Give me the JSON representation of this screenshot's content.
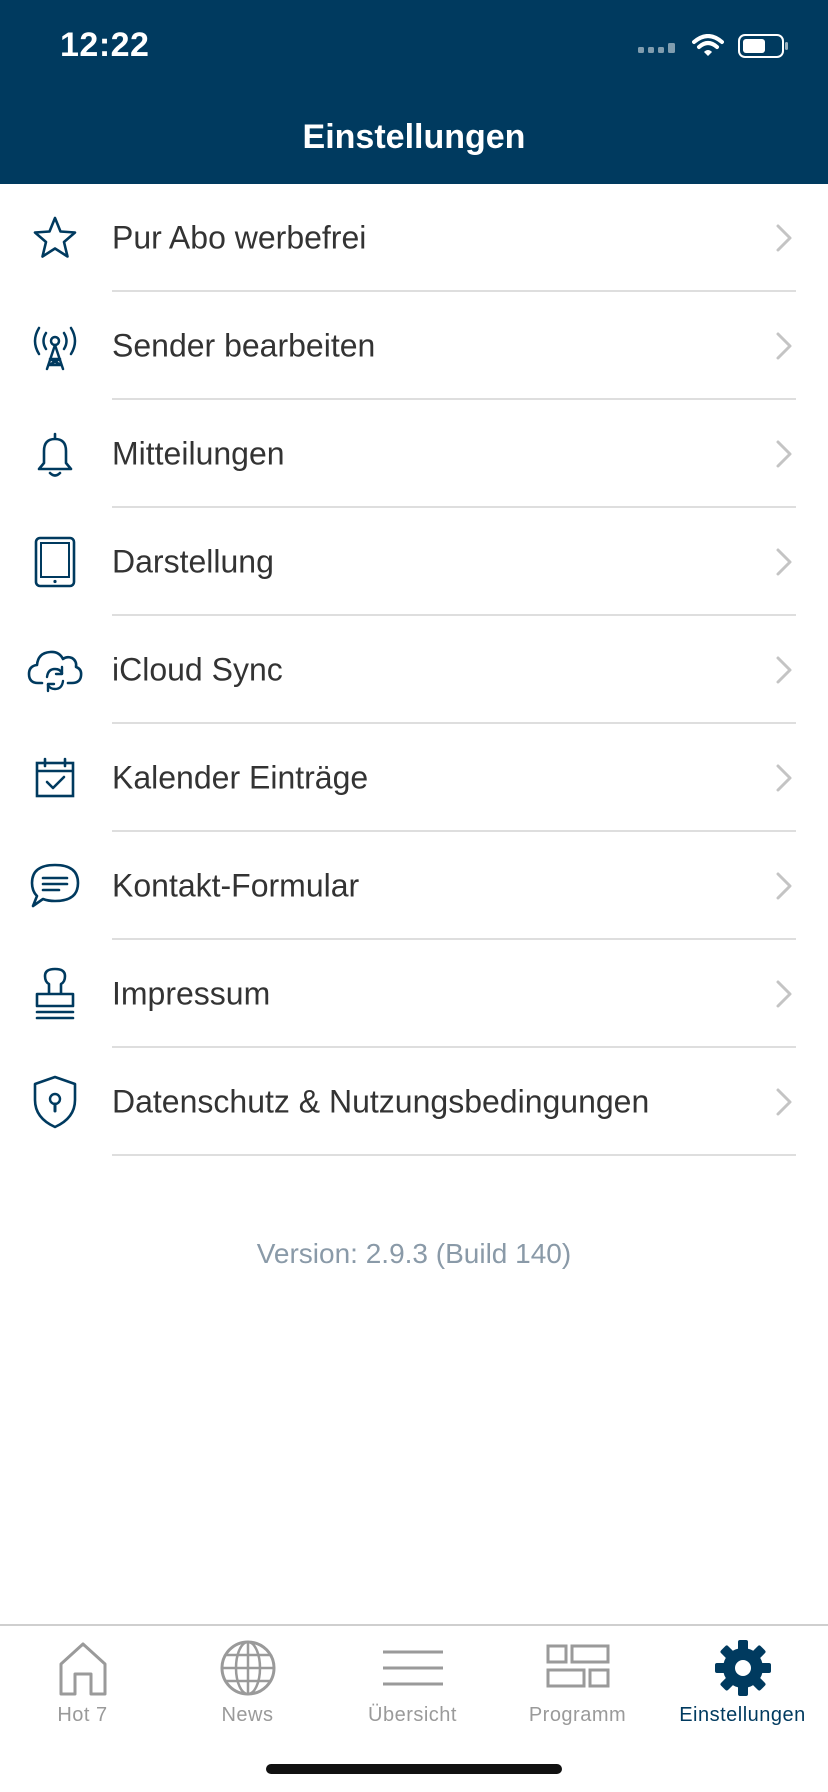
{
  "status_bar": {
    "time": "12:22"
  },
  "header": {
    "title": "Einstellungen"
  },
  "settings": {
    "items": [
      {
        "label": "Pur Abo werbefrei",
        "icon": "star-icon"
      },
      {
        "label": "Sender bearbeiten",
        "icon": "antenna-icon"
      },
      {
        "label": "Mitteilungen",
        "icon": "bell-icon"
      },
      {
        "label": "Darstellung",
        "icon": "tablet-icon"
      },
      {
        "label": "iCloud Sync",
        "icon": "cloud-sync-icon"
      },
      {
        "label": "Kalender Einträge",
        "icon": "calendar-check-icon"
      },
      {
        "label": "Kontakt-Formular",
        "icon": "chat-bubble-icon"
      },
      {
        "label": "Impressum",
        "icon": "stamp-icon"
      },
      {
        "label": "Datenschutz & Nutzungsbedingungen",
        "icon": "shield-lock-icon"
      }
    ]
  },
  "version_text": "Version: 2.9.3 (Build 140)",
  "tabbar": {
    "tabs": [
      {
        "label": "Hot 7",
        "icon": "home-icon",
        "active": false
      },
      {
        "label": "News",
        "icon": "globe-icon",
        "active": false
      },
      {
        "label": "Übersicht",
        "icon": "list-icon",
        "active": false
      },
      {
        "label": "Programm",
        "icon": "grid-icon",
        "active": false
      },
      {
        "label": "Einstellungen",
        "icon": "gear-icon",
        "active": true
      }
    ]
  },
  "colors": {
    "brand": "#003a5f",
    "label": "#333333",
    "separator": "#dedede",
    "inactive_tab": "#9a9a9a",
    "version_text": "#8a9aa8"
  }
}
